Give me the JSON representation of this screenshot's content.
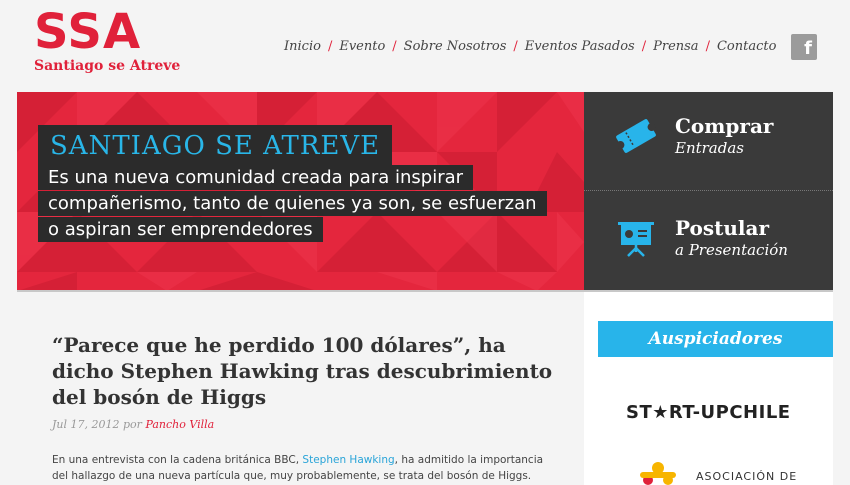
{
  "logo": {
    "mark": "SSA",
    "subtitle": "Santiago se Atreve"
  },
  "nav": {
    "items": [
      "Inicio",
      "Evento",
      "Sobre Nosotros",
      "Eventos Pasados",
      "Prensa",
      "Contacto"
    ],
    "separator": "/"
  },
  "social": {
    "facebook_label": "f",
    "icon": "facebook-icon"
  },
  "hero": {
    "title": "SANTIAGO SE ATREVE",
    "text": "Es una nueva comunidad creada para inspirar compañerismo, tanto de quienes ya son, se esfuerzan o aspiran ser emprendedores"
  },
  "actions": {
    "buy": {
      "title": "Comprar",
      "subtitle": "Entradas",
      "icon": "ticket-icon"
    },
    "apply": {
      "title": "Postular",
      "subtitle": "a Presentación",
      "icon": "presentation-icon"
    }
  },
  "post": {
    "title": "“Parece que he perdido 100 dólares”, ha dicho Stephen Hawking tras descubrimiento del bosón de Higgs",
    "date": "Jul 17, 2012",
    "by": "por",
    "author": "Pancho Villa",
    "excerpt_before": "En una entrevista con la cadena británica BBC, ",
    "excerpt_link": "Stephen Hawking",
    "excerpt_after": ", ha admitido la importancia del hallazgo de una nueva partícula que, muy probablemente, se trata del bosón de Higgs."
  },
  "sponsors": {
    "title": "Auspiciadores",
    "items": [
      "ST★RT-UPCHILE",
      "ASOCIACIÓN DE"
    ]
  },
  "colors": {
    "brand_red": "#e0213a",
    "accent_blue": "#28b4ea",
    "dark_panel": "#3a3a3a"
  }
}
